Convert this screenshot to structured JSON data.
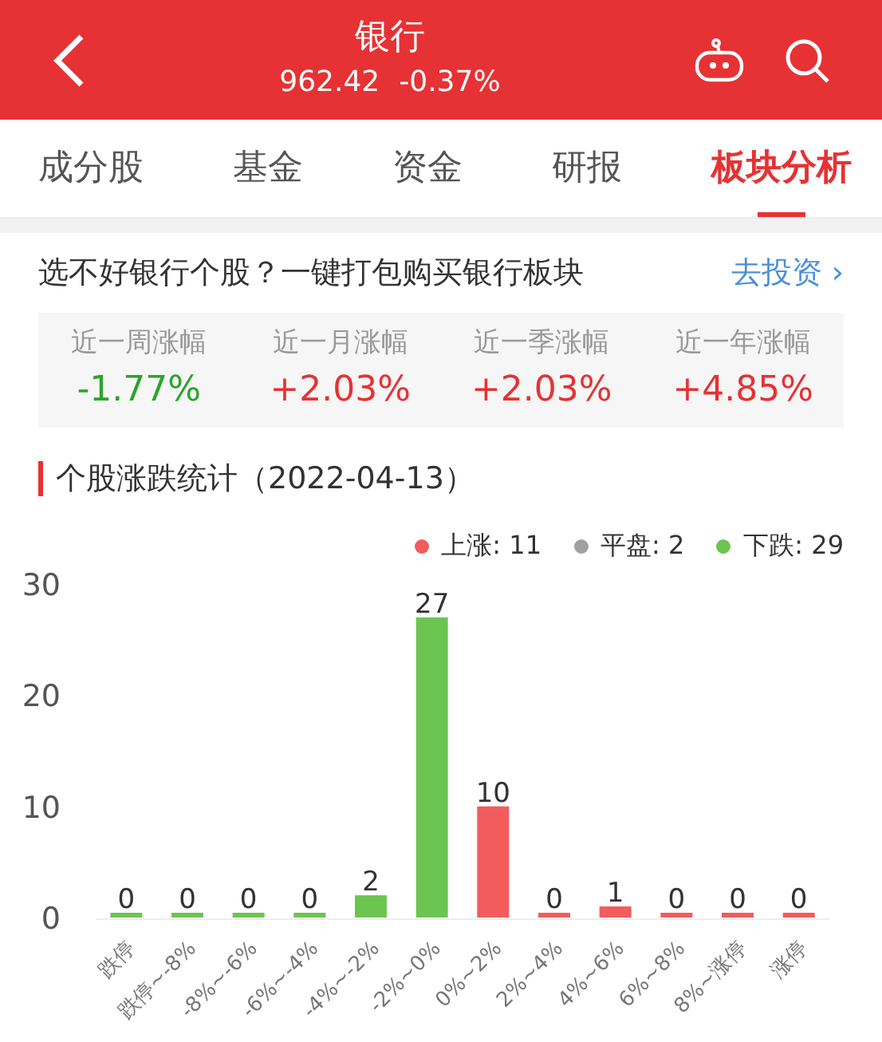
{
  "header": {
    "title": "银行",
    "price": "962.42",
    "change": "-0.37%"
  },
  "tabs": [
    {
      "label": "成分股",
      "selected": false
    },
    {
      "label": "基金",
      "selected": false
    },
    {
      "label": "资金",
      "selected": false
    },
    {
      "label": "研报",
      "selected": false
    },
    {
      "label": "板块分析",
      "selected": true
    }
  ],
  "promo": {
    "text": "选不好银行个股？一键打包购买银行板块",
    "link": "去投资",
    "link_arrow": "›"
  },
  "stats": [
    {
      "label": "近一周涨幅",
      "value": "-1.77%",
      "kind": "down"
    },
    {
      "label": "近一月涨幅",
      "value": "+2.03%",
      "kind": "up"
    },
    {
      "label": "近一季涨幅",
      "value": "+2.03%",
      "kind": "up"
    },
    {
      "label": "近一年涨幅",
      "value": "+4.85%",
      "kind": "up"
    }
  ],
  "section": {
    "title": "个股涨跌统计（2022-04-13）",
    "legend": [
      {
        "label": "上涨: 11",
        "color": "#f25c5c"
      },
      {
        "label": "平盘: 2",
        "color": "#a0a0a0"
      },
      {
        "label": "下跌: 29",
        "color": "#6cc551"
      }
    ],
    "chart_data": {
      "type": "bar",
      "stacked": true,
      "data_labels": true,
      "categories": [
        "跌停",
        "跌停~-8%",
        "-8%~-6%",
        "-6%~-4%",
        "-4%~-2%",
        "-2%~0%",
        "0%~2%",
        "2%~4%",
        "4%~6%",
        "6%~8%",
        "8%~涨停",
        "涨停"
      ],
      "ylim": [
        0,
        30
      ],
      "yticks": [
        0,
        10,
        20,
        30
      ],
      "series": [
        {
          "color": "#6cc551",
          "values": [
            0,
            0,
            0,
            0,
            2,
            27,
            null,
            null,
            null,
            null,
            null,
            null
          ]
        },
        {
          "color": "#f25c5c",
          "values": [
            null,
            null,
            null,
            null,
            null,
            null,
            10,
            0,
            1,
            0,
            0,
            0
          ]
        }
      ]
    }
  }
}
